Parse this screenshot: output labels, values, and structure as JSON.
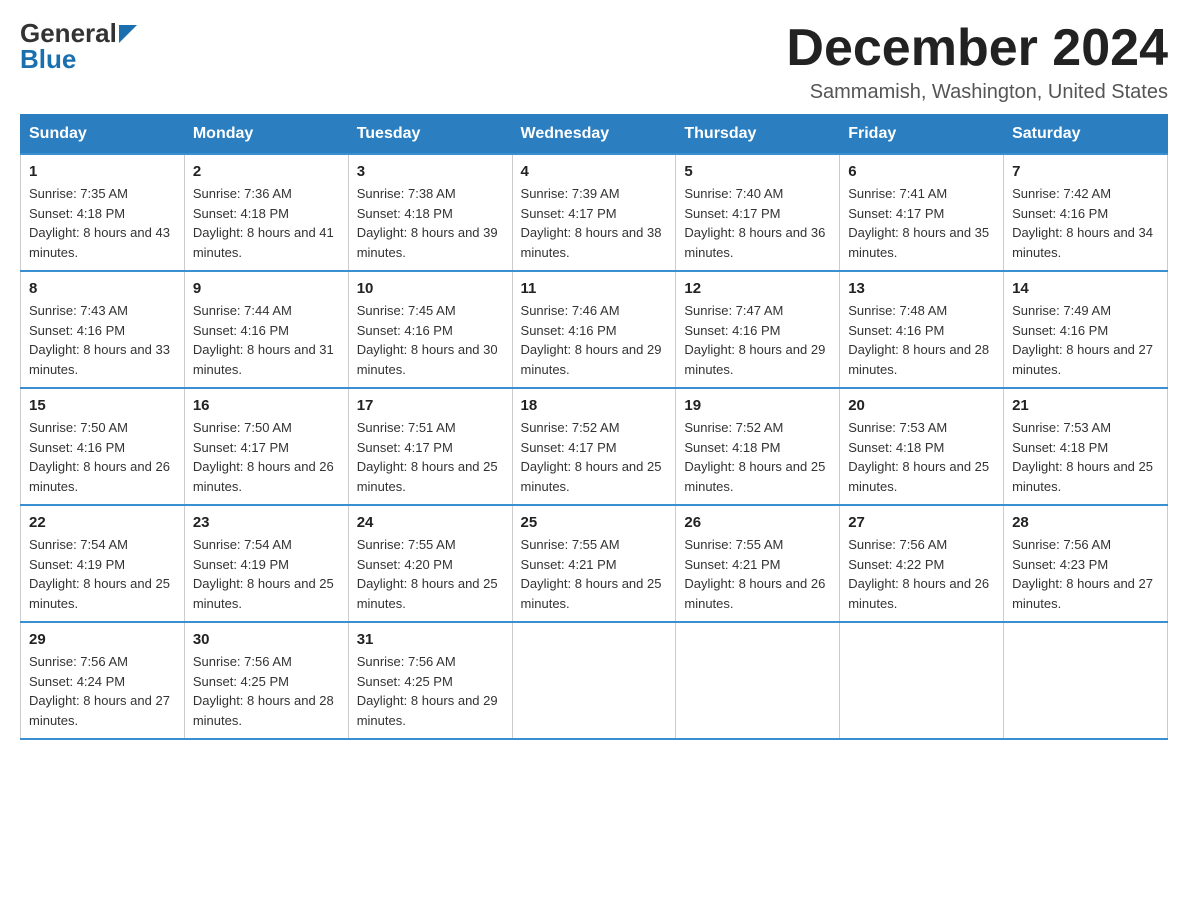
{
  "logo": {
    "general": "General",
    "blue": "Blue"
  },
  "title": "December 2024",
  "location": "Sammamish, Washington, United States",
  "headers": [
    "Sunday",
    "Monday",
    "Tuesday",
    "Wednesday",
    "Thursday",
    "Friday",
    "Saturday"
  ],
  "weeks": [
    [
      {
        "day": "1",
        "sunrise": "7:35 AM",
        "sunset": "4:18 PM",
        "daylight": "8 hours and 43 minutes."
      },
      {
        "day": "2",
        "sunrise": "7:36 AM",
        "sunset": "4:18 PM",
        "daylight": "8 hours and 41 minutes."
      },
      {
        "day": "3",
        "sunrise": "7:38 AM",
        "sunset": "4:18 PM",
        "daylight": "8 hours and 39 minutes."
      },
      {
        "day": "4",
        "sunrise": "7:39 AM",
        "sunset": "4:17 PM",
        "daylight": "8 hours and 38 minutes."
      },
      {
        "day": "5",
        "sunrise": "7:40 AM",
        "sunset": "4:17 PM",
        "daylight": "8 hours and 36 minutes."
      },
      {
        "day": "6",
        "sunrise": "7:41 AM",
        "sunset": "4:17 PM",
        "daylight": "8 hours and 35 minutes."
      },
      {
        "day": "7",
        "sunrise": "7:42 AM",
        "sunset": "4:16 PM",
        "daylight": "8 hours and 34 minutes."
      }
    ],
    [
      {
        "day": "8",
        "sunrise": "7:43 AM",
        "sunset": "4:16 PM",
        "daylight": "8 hours and 33 minutes."
      },
      {
        "day": "9",
        "sunrise": "7:44 AM",
        "sunset": "4:16 PM",
        "daylight": "8 hours and 31 minutes."
      },
      {
        "day": "10",
        "sunrise": "7:45 AM",
        "sunset": "4:16 PM",
        "daylight": "8 hours and 30 minutes."
      },
      {
        "day": "11",
        "sunrise": "7:46 AM",
        "sunset": "4:16 PM",
        "daylight": "8 hours and 29 minutes."
      },
      {
        "day": "12",
        "sunrise": "7:47 AM",
        "sunset": "4:16 PM",
        "daylight": "8 hours and 29 minutes."
      },
      {
        "day": "13",
        "sunrise": "7:48 AM",
        "sunset": "4:16 PM",
        "daylight": "8 hours and 28 minutes."
      },
      {
        "day": "14",
        "sunrise": "7:49 AM",
        "sunset": "4:16 PM",
        "daylight": "8 hours and 27 minutes."
      }
    ],
    [
      {
        "day": "15",
        "sunrise": "7:50 AM",
        "sunset": "4:16 PM",
        "daylight": "8 hours and 26 minutes."
      },
      {
        "day": "16",
        "sunrise": "7:50 AM",
        "sunset": "4:17 PM",
        "daylight": "8 hours and 26 minutes."
      },
      {
        "day": "17",
        "sunrise": "7:51 AM",
        "sunset": "4:17 PM",
        "daylight": "8 hours and 25 minutes."
      },
      {
        "day": "18",
        "sunrise": "7:52 AM",
        "sunset": "4:17 PM",
        "daylight": "8 hours and 25 minutes."
      },
      {
        "day": "19",
        "sunrise": "7:52 AM",
        "sunset": "4:18 PM",
        "daylight": "8 hours and 25 minutes."
      },
      {
        "day": "20",
        "sunrise": "7:53 AM",
        "sunset": "4:18 PM",
        "daylight": "8 hours and 25 minutes."
      },
      {
        "day": "21",
        "sunrise": "7:53 AM",
        "sunset": "4:18 PM",
        "daylight": "8 hours and 25 minutes."
      }
    ],
    [
      {
        "day": "22",
        "sunrise": "7:54 AM",
        "sunset": "4:19 PM",
        "daylight": "8 hours and 25 minutes."
      },
      {
        "day": "23",
        "sunrise": "7:54 AM",
        "sunset": "4:19 PM",
        "daylight": "8 hours and 25 minutes."
      },
      {
        "day": "24",
        "sunrise": "7:55 AM",
        "sunset": "4:20 PM",
        "daylight": "8 hours and 25 minutes."
      },
      {
        "day": "25",
        "sunrise": "7:55 AM",
        "sunset": "4:21 PM",
        "daylight": "8 hours and 25 minutes."
      },
      {
        "day": "26",
        "sunrise": "7:55 AM",
        "sunset": "4:21 PM",
        "daylight": "8 hours and 26 minutes."
      },
      {
        "day": "27",
        "sunrise": "7:56 AM",
        "sunset": "4:22 PM",
        "daylight": "8 hours and 26 minutes."
      },
      {
        "day": "28",
        "sunrise": "7:56 AM",
        "sunset": "4:23 PM",
        "daylight": "8 hours and 27 minutes."
      }
    ],
    [
      {
        "day": "29",
        "sunrise": "7:56 AM",
        "sunset": "4:24 PM",
        "daylight": "8 hours and 27 minutes."
      },
      {
        "day": "30",
        "sunrise": "7:56 AM",
        "sunset": "4:25 PM",
        "daylight": "8 hours and 28 minutes."
      },
      {
        "day": "31",
        "sunrise": "7:56 AM",
        "sunset": "4:25 PM",
        "daylight": "8 hours and 29 minutes."
      },
      null,
      null,
      null,
      null
    ]
  ]
}
